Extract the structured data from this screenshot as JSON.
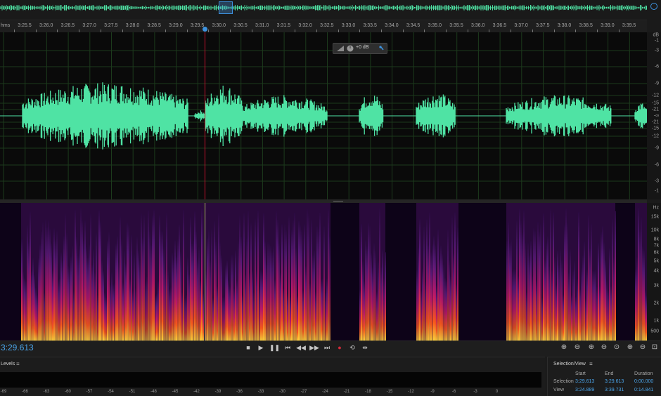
{
  "app": {
    "accent": "#4aa3e8",
    "waveform_color": "#4fe3a4"
  },
  "ruler": {
    "unit": "hms",
    "ticks": [
      "3:25.5",
      "3:26.0",
      "3:26.5",
      "3:27.0",
      "3:27.5",
      "3:28.0",
      "3:28.5",
      "3:29.0",
      "3:29.5",
      "3:30.0",
      "3:30.5",
      "3:31.0",
      "3:31.5",
      "3:32.0",
      "3:32.5",
      "3:33.0",
      "3:33.5",
      "3:34.0",
      "3:34.5",
      "3:35.0",
      "3:35.5",
      "3:36.0",
      "3:36.5",
      "3:37.0",
      "3:37.5",
      "3:38.0",
      "3:38.5",
      "3:39.0",
      "3:39.5"
    ]
  },
  "hud": {
    "gain_label": "+0 dB"
  },
  "db_scale": {
    "labels": [
      "dB",
      "-1",
      "-3",
      "-6",
      "-9",
      "-12",
      "-15",
      "-21",
      "-∞",
      "-21",
      "-15",
      "-12",
      "-9",
      "-6",
      "-3",
      "-1"
    ]
  },
  "hz_scale": {
    "labels": [
      "Hz",
      "15k",
      "10k",
      "8k",
      "7k",
      "6k",
      "5k",
      "4k",
      "3k",
      "2k",
      "1k",
      "500"
    ]
  },
  "transport": {
    "current_time": "3:29.613",
    "buttons": [
      {
        "name": "stop-button",
        "icon": "stop-icon",
        "glyph": "■"
      },
      {
        "name": "play-button",
        "icon": "play-icon",
        "glyph": "▶"
      },
      {
        "name": "pause-button",
        "icon": "pause-icon",
        "glyph": "❚❚"
      },
      {
        "name": "go-to-start-button",
        "icon": "skip-back-icon",
        "glyph": "⏮"
      },
      {
        "name": "rewind-button",
        "icon": "rewind-icon",
        "glyph": "◀◀"
      },
      {
        "name": "fast-forward-button",
        "icon": "fast-forward-icon",
        "glyph": "▶▶"
      },
      {
        "name": "go-to-end-button",
        "icon": "skip-forward-icon",
        "glyph": "⏭"
      },
      {
        "name": "record-button",
        "icon": "record-icon",
        "glyph": "●"
      },
      {
        "name": "loop-button",
        "icon": "loop-icon",
        "glyph": "⟲"
      },
      {
        "name": "skip-selection-button",
        "icon": "skip-selection-icon",
        "glyph": "⇹"
      }
    ],
    "zoom_buttons": [
      {
        "name": "zoom-in-amplitude-button",
        "icon": "zoom-in-amplitude-icon",
        "glyph": "⊕"
      },
      {
        "name": "zoom-out-amplitude-button",
        "icon": "zoom-out-amplitude-icon",
        "glyph": "⊖"
      },
      {
        "name": "zoom-in-time-button",
        "icon": "zoom-in-time-icon",
        "glyph": "⊕"
      },
      {
        "name": "zoom-out-time-button",
        "icon": "zoom-out-time-icon",
        "glyph": "⊖"
      },
      {
        "name": "zoom-out-full-button",
        "icon": "zoom-full-icon",
        "glyph": "⊙"
      },
      {
        "name": "zoom-in-point-button",
        "icon": "zoom-in-point-icon",
        "glyph": "⊕"
      },
      {
        "name": "zoom-out-point-button",
        "icon": "zoom-out-point-icon",
        "glyph": "⊖"
      },
      {
        "name": "zoom-selection-button",
        "icon": "zoom-selection-icon",
        "glyph": "⊡"
      }
    ]
  },
  "levels": {
    "title": "Levels",
    "menu": "≡",
    "scale": [
      "-69",
      "-66",
      "-63",
      "-60",
      "-57",
      "-54",
      "-51",
      "-48",
      "-45",
      "-42",
      "-39",
      "-36",
      "-33",
      "-30",
      "-27",
      "-24",
      "-21",
      "-18",
      "-15",
      "-12",
      "-9",
      "-6",
      "-3",
      "0"
    ]
  },
  "selection_view": {
    "title": "Selection/View",
    "menu": "≡",
    "headers": {
      "start": "Start",
      "end": "End",
      "duration": "Duration"
    },
    "selection": {
      "label": "Selection",
      "start": "3:29.613",
      "end": "3:29.613",
      "duration": "0:00.000"
    },
    "view": {
      "label": "View",
      "start": "3:24.889",
      "end": "3:39.731",
      "duration": "0:14.841"
    }
  }
}
